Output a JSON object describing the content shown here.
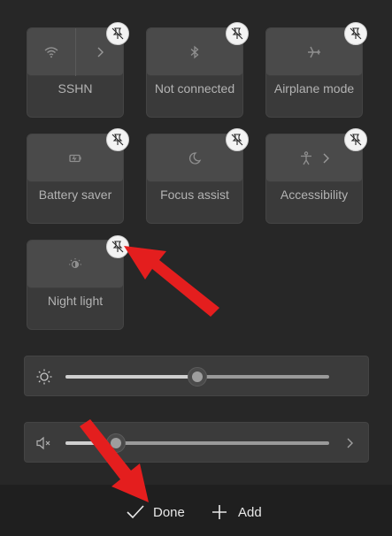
{
  "tiles": [
    {
      "label": "SSHN",
      "icon": "wifi-icon",
      "has_chevron": true
    },
    {
      "label": "Not connected",
      "icon": "bluetooth-icon"
    },
    {
      "label": "Airplane mode",
      "icon": "airplane-icon"
    },
    {
      "label": "Battery saver",
      "icon": "battery-saver-icon"
    },
    {
      "label": "Focus assist",
      "icon": "moon-icon"
    },
    {
      "label": "Accessibility",
      "icon": "accessibility-icon",
      "has_chevron": true
    },
    {
      "label": "Night light",
      "icon": "night-light-icon"
    }
  ],
  "unpin_icon": "unpin-icon",
  "sliders": {
    "brightness": {
      "icon": "brightness-icon",
      "level": 0.5
    },
    "volume": {
      "icon": "speaker-muted-icon",
      "level": 0.19
    }
  },
  "footer": {
    "done_label": "Done",
    "add_label": "Add"
  },
  "colors": {
    "background": "#272727",
    "tile": "#3a3a3a",
    "tile_button": "#4a4a4a",
    "annotation_arrow": "#e41e1e"
  }
}
